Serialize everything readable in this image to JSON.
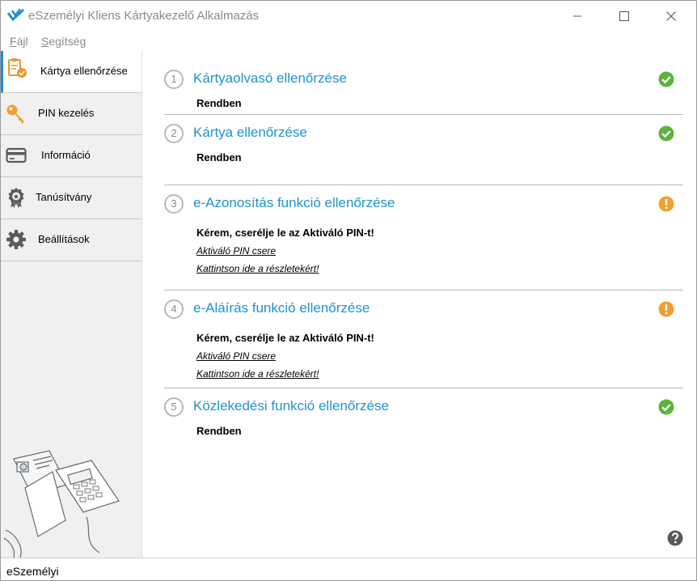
{
  "window": {
    "title": "eSzemélyi Kliens Kártyakezelő Alkalmazás"
  },
  "menu": [
    {
      "first": "F",
      "rest": "ájl"
    },
    {
      "first": "S",
      "rest": "egítség"
    }
  ],
  "sidebar": {
    "items": [
      {
        "label": "Kártya ellenőrzése",
        "icon": "clipboard-check-icon",
        "active": true
      },
      {
        "label": "PIN kezelés",
        "icon": "key-icon"
      },
      {
        "label": "Információ",
        "icon": "card-icon"
      },
      {
        "label": "Tanúsítvány",
        "icon": "certificate-icon"
      },
      {
        "label": "Beállítások",
        "icon": "gear-icon"
      }
    ]
  },
  "checks": [
    {
      "number": "1",
      "title": "Kártyaolvasó ellenőrzése",
      "status": "ok",
      "message": "Rendben"
    },
    {
      "number": "2",
      "title": "Kártya ellenőrzése",
      "status": "ok",
      "message": "Rendben"
    },
    {
      "number": "3",
      "title": "e-Azonosítás funkció ellenőrzése",
      "status": "warning",
      "message": "Kérem, cserélje le az Aktiváló PIN-t!",
      "links": [
        "Aktiváló PIN csere",
        "Kattintson ide a részletekért!"
      ]
    },
    {
      "number": "4",
      "title": "e-Aláírás funkció ellenőrzése",
      "status": "warning",
      "message": "Kérem, cserélje le az Aktiváló PIN-t!",
      "links": [
        "Aktiváló PIN csere",
        "Kattintson ide a részletekért!"
      ]
    },
    {
      "number": "5",
      "title": "Közlekedési funkció ellenőrzése",
      "status": "ok",
      "message": "Rendben"
    }
  ],
  "statusbar": {
    "text": "eSzemélyi"
  },
  "colors": {
    "accent": "#1d93cf",
    "ok": "#5db33e",
    "warning": "#f0a030"
  }
}
